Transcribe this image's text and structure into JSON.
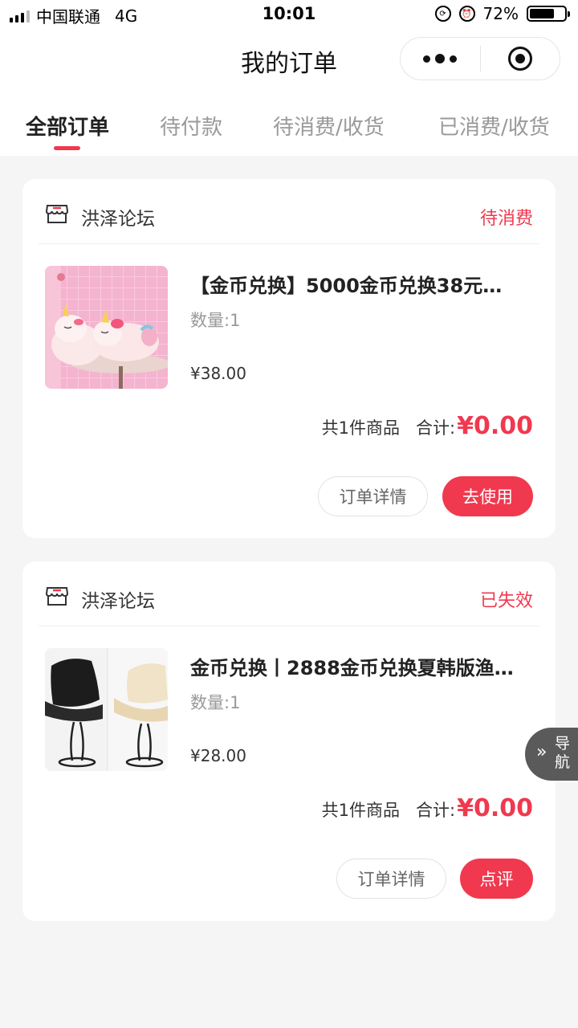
{
  "status_bar": {
    "carrier": "中国联通",
    "network": "4G",
    "time": "10:01",
    "battery": "72%",
    "battery_level": 0.72
  },
  "nav": {
    "title": "我的订单",
    "more_icon": "more-dots-icon",
    "close_icon": "target-icon"
  },
  "tabs": [
    {
      "label": "全部订单",
      "active": true
    },
    {
      "label": "待付款",
      "active": false
    },
    {
      "label": "待消费/收货",
      "active": false
    },
    {
      "label": "已消费/收货",
      "active": false
    }
  ],
  "orders": [
    {
      "shop_name": "洪泽论坛",
      "status": "待消费",
      "product_title": "【金币兑换】5000金币兑换38元…",
      "quantity": "数量:1",
      "price": "¥38.00",
      "count_text": "共1件商品",
      "total_label": "合计:",
      "total": "¥0.00",
      "buttons": [
        "订单详情",
        "去使用"
      ]
    },
    {
      "shop_name": "洪泽论坛",
      "status": "已失效",
      "product_title": "金币兑换丨2888金币兑换夏韩版渔…",
      "quantity": "数量:1",
      "price": "¥28.00",
      "count_text": "共1件商品",
      "total_label": "合计:",
      "total": "¥0.00",
      "buttons": [
        "订单详情",
        "点评"
      ]
    }
  ],
  "float_nav": {
    "label": "导航",
    "icon": "double-chevron-icon"
  },
  "colors": {
    "accent": "#f0394f",
    "background": "#f5f5f5",
    "float_nav": "#5a5a5a"
  }
}
